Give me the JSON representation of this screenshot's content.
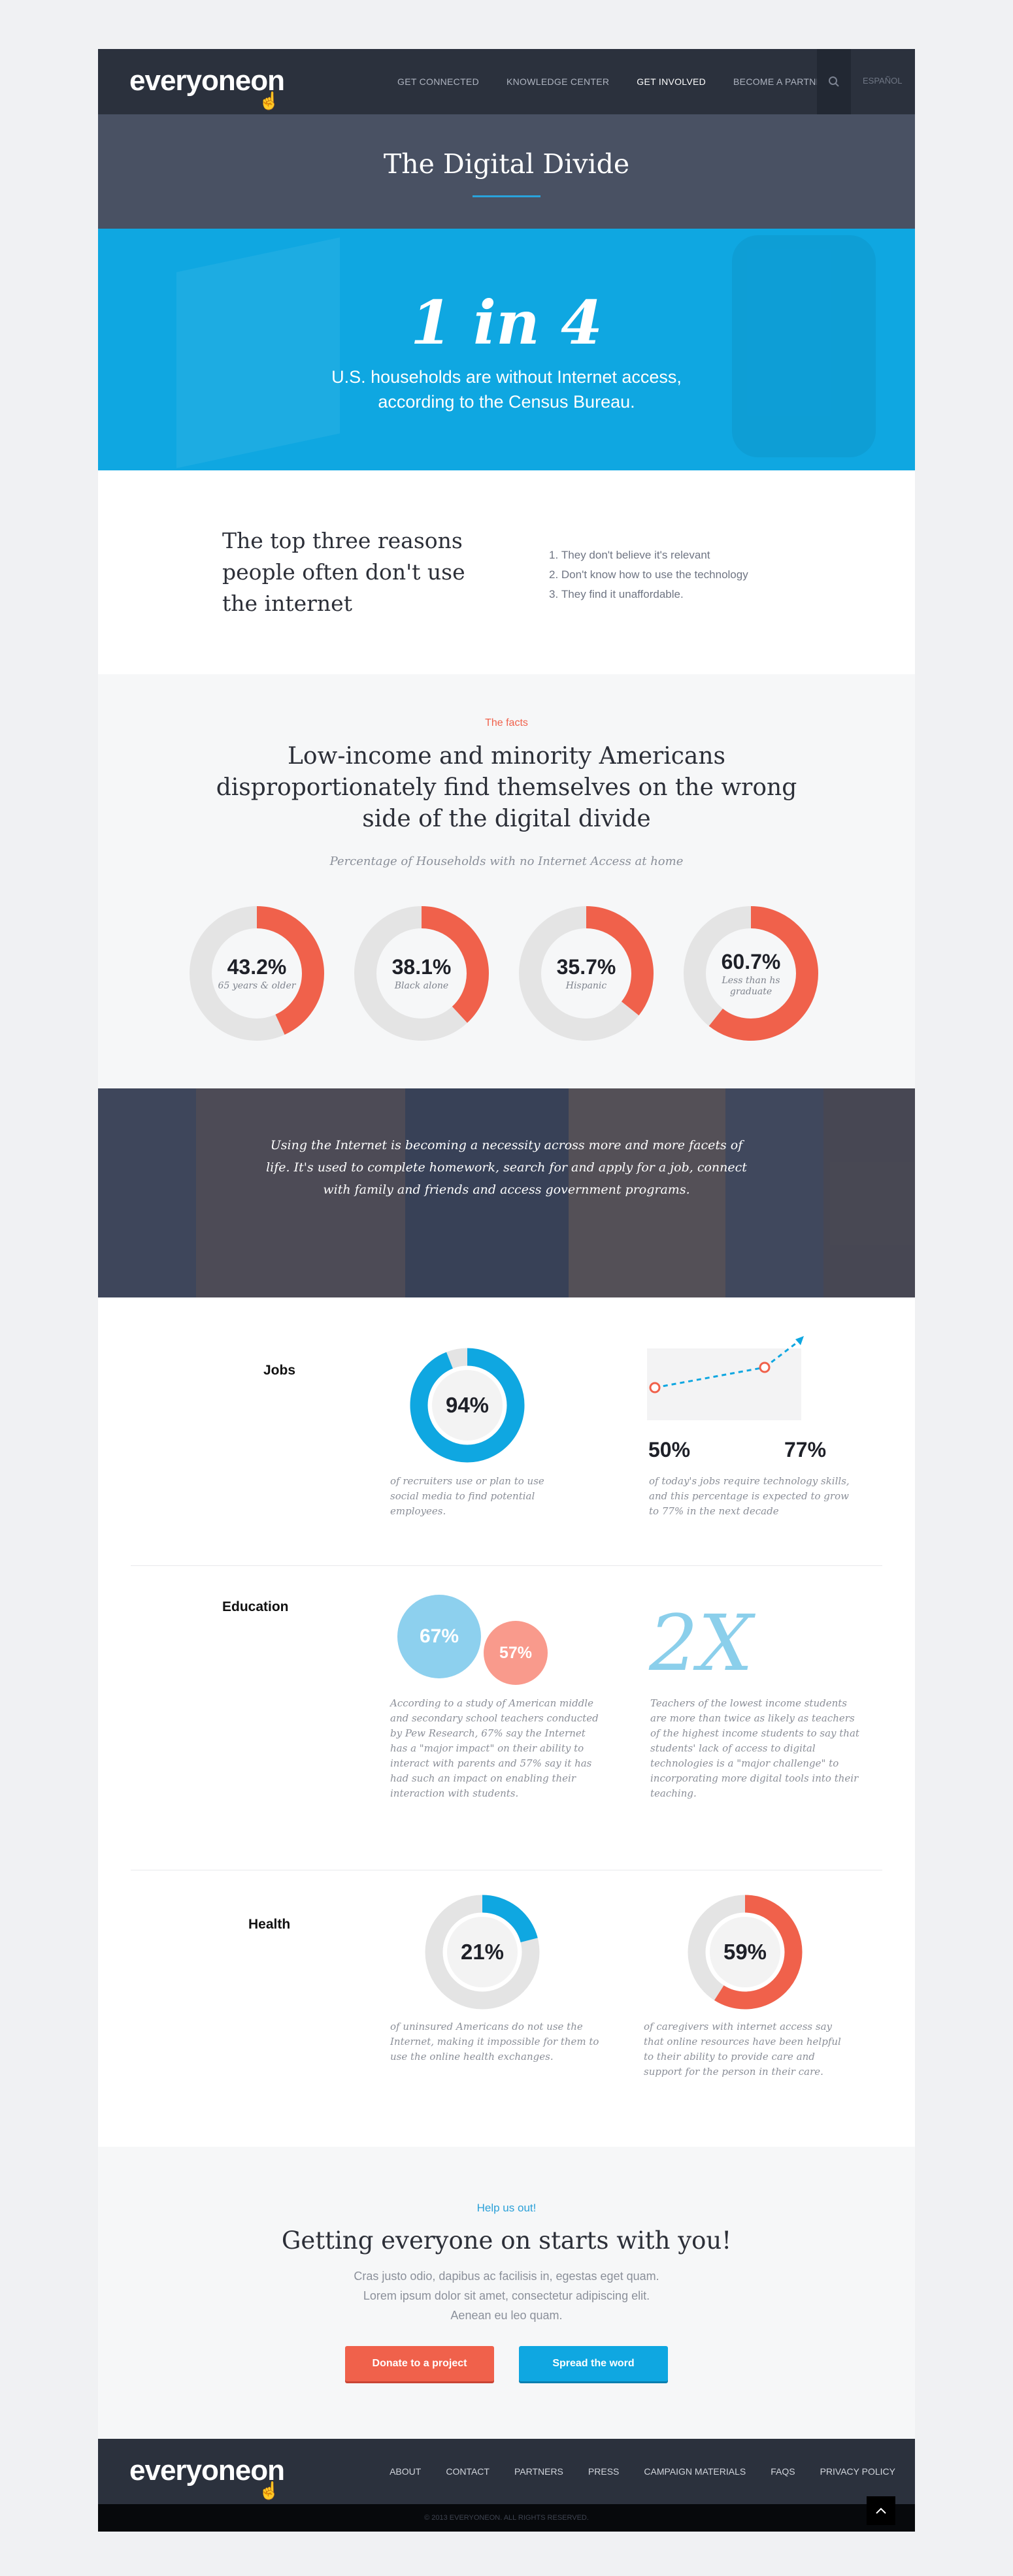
{
  "brand": {
    "logo": "everyoneon"
  },
  "nav": {
    "items": [
      "GET CONNECTED",
      "KNOWLEDGE CENTER",
      "GET INVOLVED",
      "BECOME A PARTNER"
    ],
    "language": "ESPAÑOL"
  },
  "page_title": "The Digital Divide",
  "hero": {
    "stat": "1 in 4",
    "text_line1": "U.S. households are without Internet access,",
    "text_line2": "according to the Census Bureau."
  },
  "reasons": {
    "heading": "The top three reasons people often don't use the internet",
    "items": [
      "They don't believe it's relevant",
      "Don't know how to use the technology",
      "They find it unaffordable."
    ]
  },
  "facts": {
    "eyebrow": "The facts",
    "heading": "Low-income and minority Americans disproportionately find themselves on the wrong side of the digital divide",
    "caption": "Percentage of Households with no Internet Access at home",
    "stats": [
      {
        "value": "43.2%",
        "fraction": 0.432,
        "label": "65 years & older"
      },
      {
        "value": "38.1%",
        "fraction": 0.381,
        "label": "Black alone"
      },
      {
        "value": "35.7%",
        "fraction": 0.357,
        "label": "Hispanic"
      },
      {
        "value": "60.7%",
        "fraction": 0.607,
        "label": "Less than hs graduate"
      }
    ]
  },
  "strip": {
    "text": "Using the Internet is becoming a necessity across more and more facets of life. It's used to complete homework, search for and apply for a job, connect with family and friends and access government programs."
  },
  "jobs": {
    "heading": "Jobs",
    "ring_value": "94%",
    "ring_fraction": 0.94,
    "ring_note": "of recruiters use or plan to use social media to find potential employees.",
    "from_value": "50%",
    "to_value": "77%",
    "trend_note": "of today's jobs require technology skills, and this percentage is expected to grow to 77% in the next decade"
  },
  "education": {
    "heading": "Education",
    "bubble1": "67%",
    "bubble2": "57%",
    "bubble_note": "According to a study of American middle and secondary school teachers conducted by Pew Research, 67% say the Internet has a \"major impact\" on their ability to interact with parents and 57% say it has had such an impact on enabling their interaction with students.",
    "multiplier": "2X",
    "multiplier_note": "Teachers of the lowest income students are more than twice as likely as teachers of the highest income students to say that students' lack of access to digital technologies is a \"major challenge\" to incorporating more digital tools into their teaching."
  },
  "health": {
    "heading": "Health",
    "ring1_value": "21%",
    "ring1_fraction": 0.21,
    "ring1_note": "of uninsured Americans do not use the Internet, making it impossible for them to use the online health exchanges.",
    "ring2_value": "59%",
    "ring2_fraction": 0.59,
    "ring2_note": "of caregivers with internet access say that online resources have been helpful to their ability to provide care and support for the person in their care."
  },
  "help": {
    "eyebrow": "Help us out!",
    "heading": "Getting everyone on starts with you!",
    "line1": "Cras justo odio, dapibus ac facilisis in, egestas eget quam.",
    "line2": "Lorem ipsum dolor sit amet, consectetur adipiscing elit.",
    "line3": "Aenean eu leo quam.",
    "donate_label": "Donate to a project",
    "spread_label": "Spread the word"
  },
  "footer": {
    "items": [
      "ABOUT",
      "CONTACT",
      "PARTNERS",
      "PRESS",
      "CAMPAIGN MATERIALS",
      "FAQS",
      "PRIVACY POLICY"
    ],
    "copyright": "© 2013 EVERYONEON. ALL RIGHTS RESERVED."
  },
  "colors": {
    "accent_red": "#f0614b",
    "accent_blue": "#0fa7e1",
    "dark": "#2b313d",
    "ring_gray": "#e4e4e4"
  }
}
